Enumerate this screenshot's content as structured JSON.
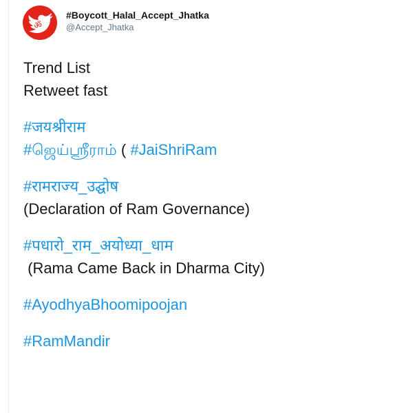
{
  "tweet": {
    "author": {
      "display_name": "#Boycott_Halal_Accept_Jhatka",
      "handle": "@Accept_Jhatka",
      "avatar_icon": "om-bird-avatar-icon",
      "avatar_color": "#e2231a"
    },
    "lines": {
      "l1": "Trend List",
      "l2": "Retweet fast",
      "l3": "#जयश्रीराम",
      "l4a": "#ஜெய்ஸ்ரீராம்",
      "l4b": " ( ",
      "l4c": "#JaiShriRam",
      "l5": "#रामराज्य_उद्घोष",
      "l6": "(Declaration of Ram Governance)",
      "l7": "#पधारो_राम_अयोध्या_धाम",
      "l8": " (Rama Came Back in Dharma City)",
      "l9": "#AyodhyaBhoomipoojan",
      "l10": "#RamMandir"
    },
    "link_color": "#1b95e0",
    "text_color": "#14171a"
  }
}
